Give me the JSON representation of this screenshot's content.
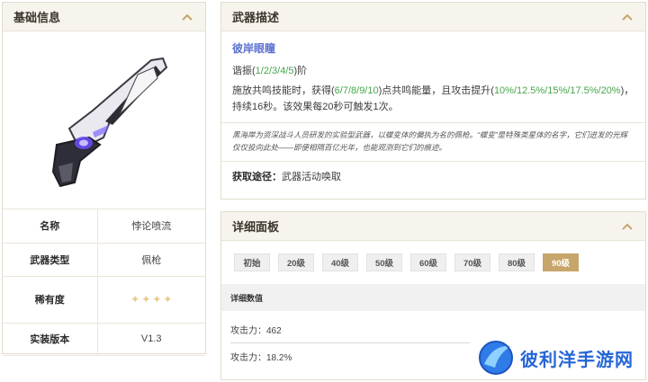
{
  "basic_panel": {
    "title": "基础信息",
    "rows": [
      {
        "label": "名称",
        "value": "悖论喷流"
      },
      {
        "label": "武器类型",
        "value": "佩枪"
      },
      {
        "label": "稀有度",
        "stars": 4
      },
      {
        "label": "实装版本",
        "value": "V1.3"
      }
    ]
  },
  "desc_panel": {
    "title": "武器描述",
    "weapon_name": "彼岸眼瞳",
    "resonance_prefix": "谐振(",
    "resonance_levels": "1/2/3/4/5",
    "resonance_suffix": ")阶",
    "skill_part1": "施放共鸣技能时，获得(",
    "skill_energy": "6/7/8/9/10",
    "skill_part2": ")点共鸣能量，且攻击提升(",
    "skill_atk": "10%/12.5%/15%/17.5%/20%",
    "skill_part3": ")，持续16秒。该效果每20秒可触发1次。",
    "lore": "黑海岸为资深战斗人员研发的实验型武器，以蝶变体的偏执为名的佩枪。“蝶变”是特殊类星体的名字，它们迸发的光辉仅仅投向此处——即便相隔百亿光年，也能观测到它们的痕迹。",
    "source_label": "获取途径：",
    "source_value": "武器活动唤取"
  },
  "detail_panel": {
    "title": "详细面板",
    "levels": [
      "初始",
      "20级",
      "40级",
      "50级",
      "60级",
      "70级",
      "80级",
      "90级"
    ],
    "active_level": "90级",
    "stats_header": "详细数值",
    "stat_atk": "攻击力：462",
    "stat_atk_pct": "攻击力：18.2%"
  },
  "watermark": {
    "text": "彼利洋手游网"
  },
  "colors": {
    "accent_gold": "#c7a56b",
    "highlight_green": "#47a64b",
    "name_blue": "#5a6fd0",
    "watermark_blue": "#2566d6"
  }
}
